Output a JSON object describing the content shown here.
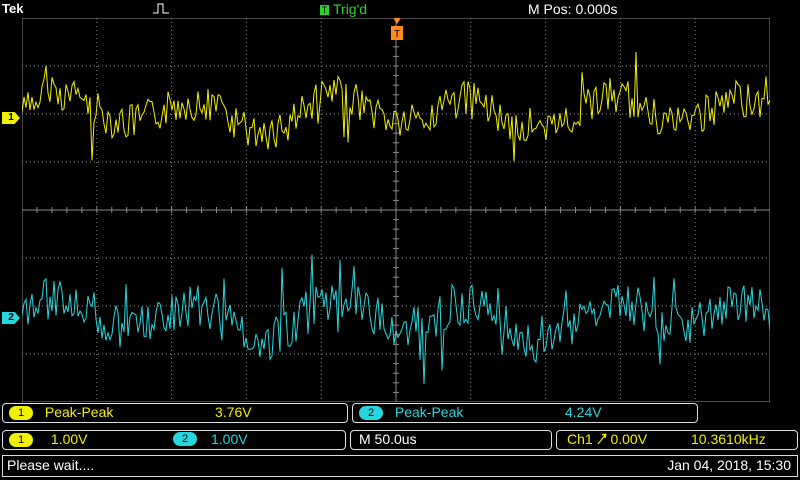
{
  "header": {
    "brand": "Tek",
    "trigger_status": "Trig'd",
    "trigger_badge": "T",
    "horizontal_position": "M Pos: 0.000s"
  },
  "channels": {
    "ch1": {
      "label": "1",
      "color": "#f0f000"
    },
    "ch2": {
      "label": "2",
      "color": "#27d6dd"
    }
  },
  "measurements": [
    {
      "channel": "1",
      "type": "Peak-Peak",
      "value": "3.76V"
    },
    {
      "channel": "2",
      "type": "Peak-Peak",
      "value": "4.24V"
    }
  ],
  "settings": {
    "ch1_scale": "1.00V",
    "ch2_scale": "1.00V",
    "timebase": "M 50.0us",
    "trigger_source": "Ch1",
    "trigger_level": "0.00V",
    "frequency": "10.3610kHz"
  },
  "status": {
    "message": "Please wait....",
    "datetime": "Jan 04, 2018, 15:30"
  }
}
